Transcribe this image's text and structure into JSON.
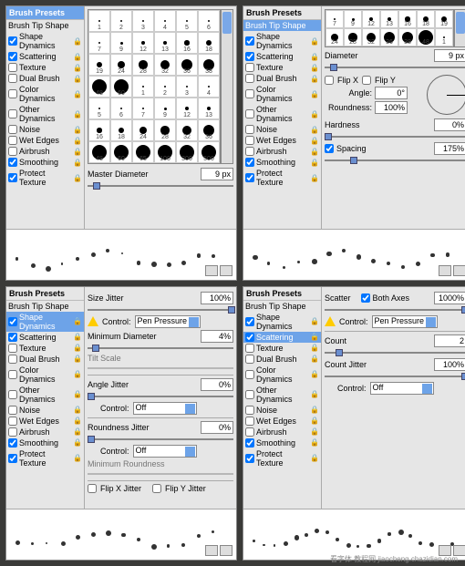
{
  "sidebar": {
    "head": "Brush Presets",
    "tip": "Brush Tip Shape",
    "opts": [
      {
        "k": "shape",
        "label": "Shape Dynamics",
        "chk": true
      },
      {
        "k": "scatter",
        "label": "Scattering",
        "chk": true
      },
      {
        "k": "texture",
        "label": "Texture",
        "chk": false
      },
      {
        "k": "dual",
        "label": "Dual Brush",
        "chk": false
      },
      {
        "k": "color",
        "label": "Color Dynamics",
        "chk": false
      },
      {
        "k": "other",
        "label": "Other Dynamics",
        "chk": false
      },
      {
        "k": "noise",
        "label": "Noise",
        "chk": false
      },
      {
        "k": "wet",
        "label": "Wet Edges",
        "chk": false
      },
      {
        "k": "air",
        "label": "Airbrush",
        "chk": false
      },
      {
        "k": "smooth",
        "label": "Smoothing",
        "chk": true
      },
      {
        "k": "protect",
        "label": "Protect Texture",
        "chk": true
      }
    ]
  },
  "q1": {
    "sel": "head",
    "brushes": [
      1,
      2,
      3,
      4,
      5,
      6,
      7,
      9,
      12,
      13,
      16,
      18,
      19,
      24,
      28,
      32,
      36,
      38,
      48,
      60,
      1,
      2,
      3,
      4,
      5,
      6,
      7,
      9,
      12,
      13,
      16,
      18,
      24,
      28,
      32,
      36,
      48,
      60,
      65,
      100,
      300,
      500
    ],
    "master_label": "Master Diameter",
    "master": "9 px"
  },
  "q2": {
    "sel": "tip",
    "brushes": [
      7,
      9,
      12,
      13,
      16,
      18,
      19,
      24,
      28,
      32,
      36,
      38,
      48,
      1
    ],
    "diameter_label": "Diameter",
    "diameter": "9 px",
    "flipx": "Flip X",
    "flipy": "Flip Y",
    "angle_label": "Angle:",
    "angle": "0°",
    "round_label": "Roundness:",
    "round": "100%",
    "hard_label": "Hardness",
    "hard": "0%",
    "spacing_label": "Spacing",
    "spacing": "175%",
    "spacing_chk": true
  },
  "q3": {
    "sel": "shape",
    "sizejitter_label": "Size Jitter",
    "sizejitter": "100%",
    "control_label": "Control:",
    "pen": "Pen Pressure",
    "off": "Off",
    "mindia_label": "Minimum Diameter",
    "mindia": "4%",
    "tilt_label": "Tilt Scale",
    "anglejitter_label": "Angle Jitter",
    "anglejitter": "0%",
    "roundjitter_label": "Roundness Jitter",
    "roundjitter": "0%",
    "minround_label": "Minimum Roundness",
    "flipxj": "Flip X Jitter",
    "flipyj": "Flip Y Jitter"
  },
  "q4": {
    "sel": "scatter",
    "scatter_label": "Scatter",
    "bothaxes": "Both Axes",
    "bothaxes_chk": true,
    "scatter": "1000%",
    "control_label": "Control:",
    "pen": "Pen Pressure",
    "off": "Off",
    "count_label": "Count",
    "count": "2",
    "countjitter_label": "Count Jitter",
    "countjitter": "100%"
  },
  "watermark": "看字体 教程网 jiaocheng.chazidian.com"
}
